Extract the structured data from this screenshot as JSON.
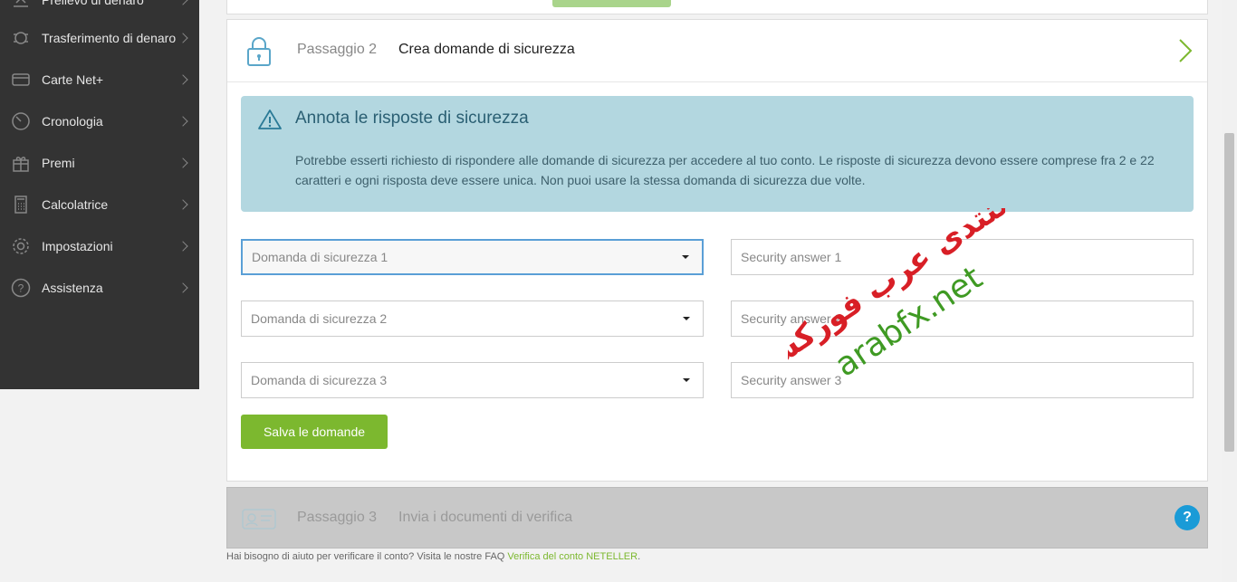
{
  "sidebar": {
    "items": [
      {
        "label": "Prelievo di denaro",
        "icon": "withdraw-icon"
      },
      {
        "label": "Trasferimento di denaro",
        "icon": "transfer-icon"
      },
      {
        "label": "Carte Net+",
        "icon": "card-icon"
      },
      {
        "label": "Cronologia",
        "icon": "history-icon"
      },
      {
        "label": "Premi",
        "icon": "gift-icon"
      },
      {
        "label": "Calcolatrice",
        "icon": "calculator-icon"
      },
      {
        "label": "Impostazioni",
        "icon": "gear-icon"
      },
      {
        "label": "Assistenza",
        "icon": "help-icon"
      }
    ]
  },
  "step2": {
    "number": "Passaggio 2",
    "title": "Crea domande di sicurezza"
  },
  "alert": {
    "title": "Annota le risposte di sicurezza",
    "body": "Potrebbe esserti richiesto di rispondere alle domande di sicurezza per accedere al tuo conto. Le risposte di sicurezza devono essere comprese fra 2 e 22 caratteri e ogni risposta deve essere unica. Non puoi usare la stessa domanda di sicurezza due volte."
  },
  "questions": [
    {
      "select": "Domanda di sicurezza 1",
      "answer_placeholder": "Security answer 1"
    },
    {
      "select": "Domanda di sicurezza 2",
      "answer_placeholder": "Security answer 2"
    },
    {
      "select": "Domanda di sicurezza 3",
      "answer_placeholder": "Security answer 3"
    }
  ],
  "save_label": "Salva le domande",
  "step3": {
    "number": "Passaggio 3",
    "title": "Invia i documenti di verifica",
    "help_label": "?"
  },
  "footer": {
    "text": "Hai bisogno di aiuto per verificare il conto? Visita le nostre FAQ ",
    "link": "Verifica del conto NETELLER",
    "suffix": "."
  },
  "watermark": {
    "arabic": "منتدى عرب فوركس",
    "site": "arabfx.net"
  },
  "colors": {
    "accent_green": "#7cb82f",
    "alert_bg": "#b3d7e0",
    "sidebar_bg": "#333333",
    "help_blue": "#1a9bd7"
  }
}
